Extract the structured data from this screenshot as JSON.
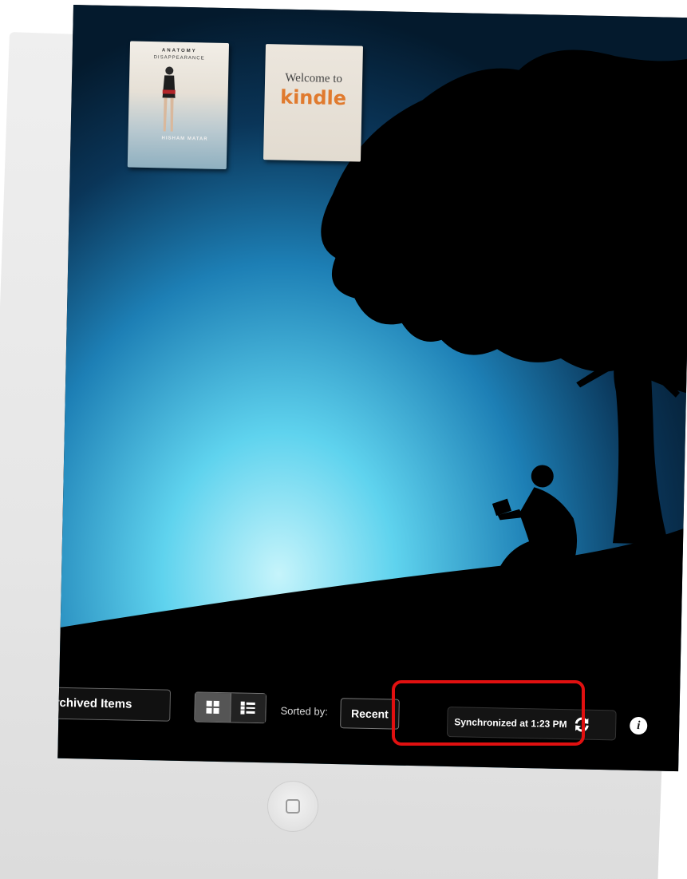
{
  "library": {
    "books": [
      {
        "title": "ANATOMY",
        "subtitle": "DISAPPEARANCE",
        "author": "HISHAM MATAR"
      },
      {
        "welcome": "Welcome to",
        "brand": "kindle"
      }
    ]
  },
  "toolbar": {
    "archived_label": "rchived Items",
    "sorted_by_label": "Sorted by:",
    "sort_value": "Recent",
    "sync_status": "Synchronized at 1:23 PM",
    "info_glyph": "i"
  },
  "icons": {
    "grid_view": "grid-view-icon",
    "list_view": "list-view-icon",
    "sync": "sync-icon",
    "info": "info-icon",
    "home": "home-icon"
  },
  "colors": {
    "highlight": "#e01010",
    "kindle_orange": "#e07a2e"
  }
}
